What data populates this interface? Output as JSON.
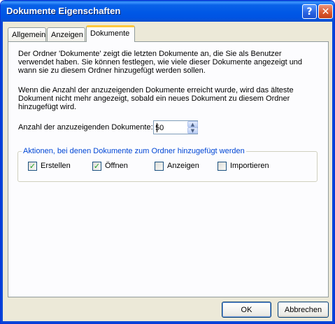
{
  "window": {
    "title": "Dokumente Eigenschaften",
    "help_glyph": "?",
    "close_glyph": "✕"
  },
  "tabs": [
    {
      "label": "Allgemein",
      "active": false
    },
    {
      "label": "Anzeigen",
      "active": false
    },
    {
      "label": "Dokumente",
      "active": true
    }
  ],
  "content": {
    "description1": "Der Ordner 'Dokumente' zeigt die letzten Dokumente an, die Sie als Benutzer verwendet haben. Sie können festlegen, wie viele dieser Dokumente angezeigt und wann sie zu diesem Ordner hinzugefügt werden sollen.",
    "description2": "Wenn die Anzahl der anzuzeigenden Dokumente erreicht wurde, wird das älteste Dokument nicht mehr angezeigt, sobald ein neues Dokument zu diesem Ordner hinzugefügt wird.",
    "count_label": "Anzahl der anzuzeigenden Dokumente:",
    "count_value": "50"
  },
  "group": {
    "legend": "Aktionen, bei denen Dokumente zum Ordner hinzugefügt werden",
    "checkboxes": [
      {
        "label": "Erstellen",
        "checked": true
      },
      {
        "label": "Öffnen",
        "checked": true
      },
      {
        "label": "Anzeigen",
        "checked": false
      },
      {
        "label": "Importieren",
        "checked": false
      }
    ]
  },
  "buttons": {
    "ok": "OK",
    "cancel": "Abbrechen"
  },
  "colors": {
    "titlebar": "#0054e3",
    "dialog_bg": "#ece9d8",
    "group_legend": "#0046d5",
    "check_mark": "#21a121",
    "active_tab_highlight": "#ffc83c"
  }
}
